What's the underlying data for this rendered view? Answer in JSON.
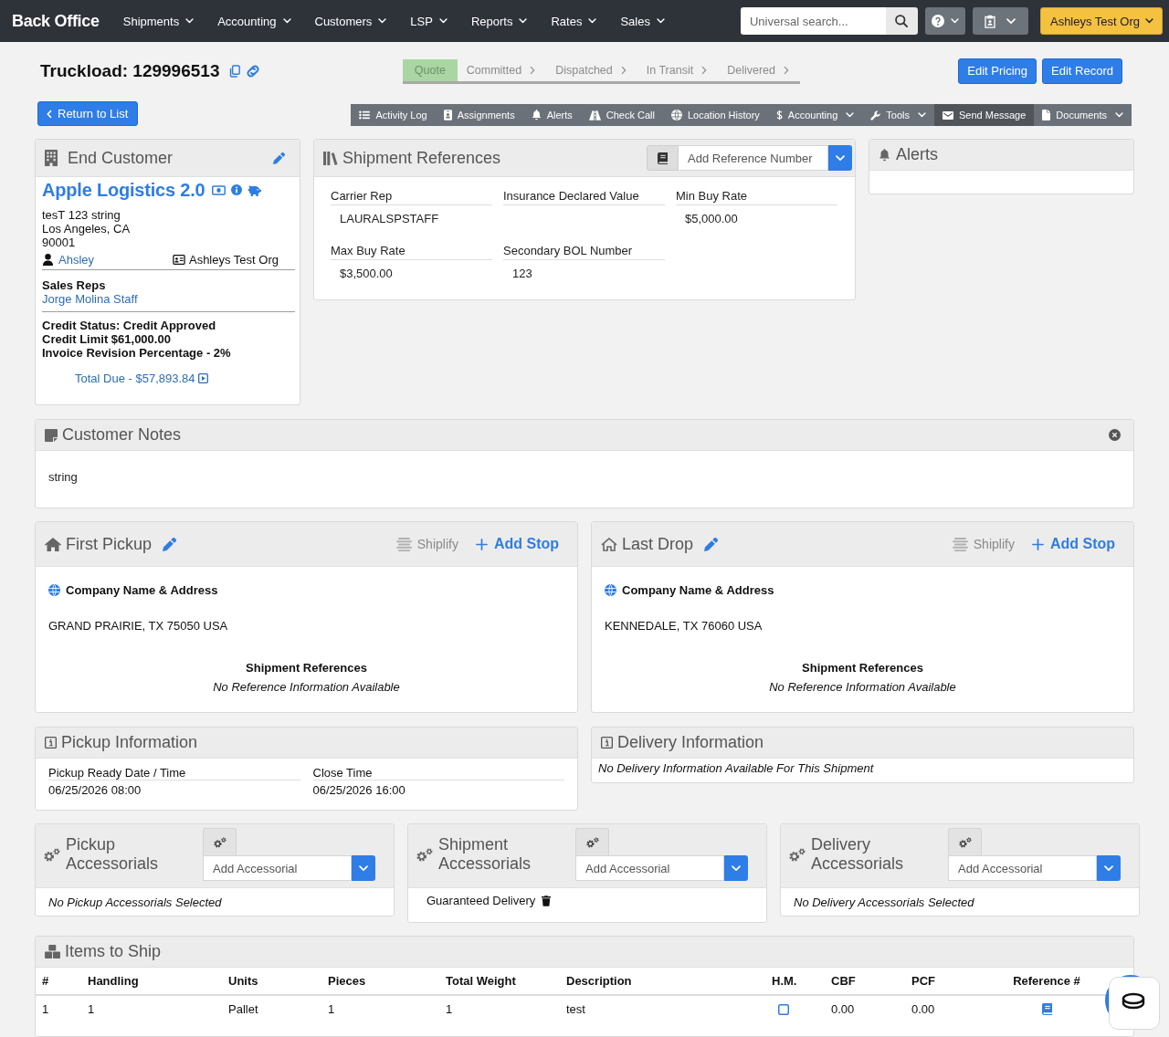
{
  "navbar": {
    "brand": "Back Office",
    "menus": [
      "Shipments",
      "Accounting",
      "Customers",
      "LSP",
      "Reports",
      "Rates",
      "Sales"
    ],
    "search": {
      "placeholder": "Universal search..."
    },
    "organization_button": "Ashleys Test Org"
  },
  "header": {
    "title": "Truckload: 129996513",
    "progress": [
      {
        "label": "Quote",
        "selected": true
      },
      {
        "label": "Committed",
        "selected": false
      },
      {
        "label": "Dispatched",
        "selected": false
      },
      {
        "label": "In Transit",
        "selected": false
      },
      {
        "label": "Delivered",
        "selected": false
      }
    ],
    "actions": [
      "Edit Pricing",
      "Edit Record"
    ],
    "return_button": "Return to List",
    "toolbar": [
      {
        "label": "Activity Log",
        "dropdown": false,
        "selected": false
      },
      {
        "label": "Assignments",
        "dropdown": false,
        "selected": false
      },
      {
        "label": "Alerts",
        "dropdown": false,
        "selected": false
      },
      {
        "label": "Check Call",
        "dropdown": false,
        "selected": false
      },
      {
        "label": "Location History",
        "dropdown": false,
        "selected": false
      },
      {
        "label": "Accounting",
        "dropdown": true,
        "selected": false
      },
      {
        "label": "Tools",
        "dropdown": true,
        "selected": false
      },
      {
        "label": "Send Message",
        "dropdown": false,
        "selected": true
      },
      {
        "label": "Documents",
        "dropdown": true,
        "selected": false
      }
    ]
  },
  "end_customer": {
    "title": "End Customer",
    "company": "Apple Logistics 2.0",
    "address": [
      "tesT 123 string",
      "Los Angeles, CA",
      "90001"
    ],
    "contact": "Ahsley",
    "organization": "Ashleys Test Org",
    "sales_reps": {
      "label": "Sales Reps",
      "names": [
        "Jorge Molina Staff"
      ]
    },
    "credit": [
      "Credit Status: Credit Approved",
      "Credit Limit $61,000.00",
      "Invoice Revision Percentage - 2%"
    ],
    "total_due": "Total Due - $57,893.84"
  },
  "shipment_references": {
    "title": "Shipment References",
    "reference_field": {
      "placeholder": "Add Reference Number"
    },
    "fields": [
      {
        "label": "Carrier Rep",
        "value": "LAURALSPSTAFF"
      },
      {
        "label": "Insurance Declared Value"
      },
      {
        "label": "Min Buy Rate",
        "value": "$5,000.00"
      },
      {
        "label": "Max Buy Rate",
        "value": "$3,500.00"
      },
      {
        "label": "Secondary BOL Number",
        "value": "123"
      }
    ]
  },
  "alerts": {
    "title": "Alerts"
  },
  "customer_notes": {
    "title": "Customer Notes",
    "text": "string"
  },
  "stops": [
    {
      "kind": "pickup",
      "title": "First Pickup",
      "shiplify": {
        "label": "Shiplify",
        "disabled": true
      },
      "add_stop": "Add Stop",
      "address_label": "Company Name & Address",
      "address": "GRAND PRAIRIE, TX 75050 USA",
      "references_title": "Shipment References",
      "references_empty": "No Reference Information Available"
    },
    {
      "kind": "drop",
      "title": "Last Drop",
      "shiplify": {
        "label": "Shiplify",
        "disabled": true
      },
      "add_stop": "Add Stop",
      "address_label": "Company Name & Address",
      "address": "KENNEDALE, TX 76060 USA",
      "references_title": "Shipment References",
      "references_empty": "No Reference Information Available"
    }
  ],
  "stop_info": [
    {
      "title": "Pickup Information",
      "fields": [
        {
          "label": "Pickup Ready Date / Time",
          "value": "06/25/2026 08:00"
        },
        {
          "label": "Close Time",
          "value": "06/25/2026 16:00"
        }
      ]
    },
    {
      "title": "Delivery Information",
      "empty_text": "No Delivery Information Available For This Shipment"
    }
  ],
  "accessorials": [
    {
      "title": "Pickup Accessorials",
      "field": {
        "placeholder": "Add Accessorial"
      },
      "empty_text": "No Pickup Accessorials Selected"
    },
    {
      "title": "Shipment Accessorials",
      "field": {
        "placeholder": "Add Accessorial"
      },
      "items": [
        "Guaranteed Delivery"
      ]
    },
    {
      "title": "Delivery Accessorials",
      "field": {
        "placeholder": "Add Accessorial"
      },
      "empty_text": "No Delivery Accessorials Selected"
    }
  ],
  "items_to_ship": {
    "title": "Items to Ship",
    "columns": [
      "#",
      "Handling",
      "Units",
      "Pieces",
      "Total Weight",
      "Description",
      "H.M.",
      "CBF",
      "PCF",
      "Reference #"
    ],
    "rows": [
      {
        "cells": [
          {
            "kind": "text",
            "text": "1"
          },
          {
            "kind": "text",
            "text": "1"
          },
          {
            "kind": "text",
            "text": "Pallet"
          },
          {
            "kind": "text",
            "text": "1"
          },
          {
            "kind": "text",
            "text": "1"
          },
          {
            "kind": "text",
            "text": "test"
          },
          {
            "kind": "checkbox",
            "checked": false
          },
          {
            "kind": "text",
            "text": "0.00"
          },
          {
            "kind": "text",
            "text": "0.00"
          },
          {
            "kind": "reference"
          }
        ]
      }
    ]
  }
}
